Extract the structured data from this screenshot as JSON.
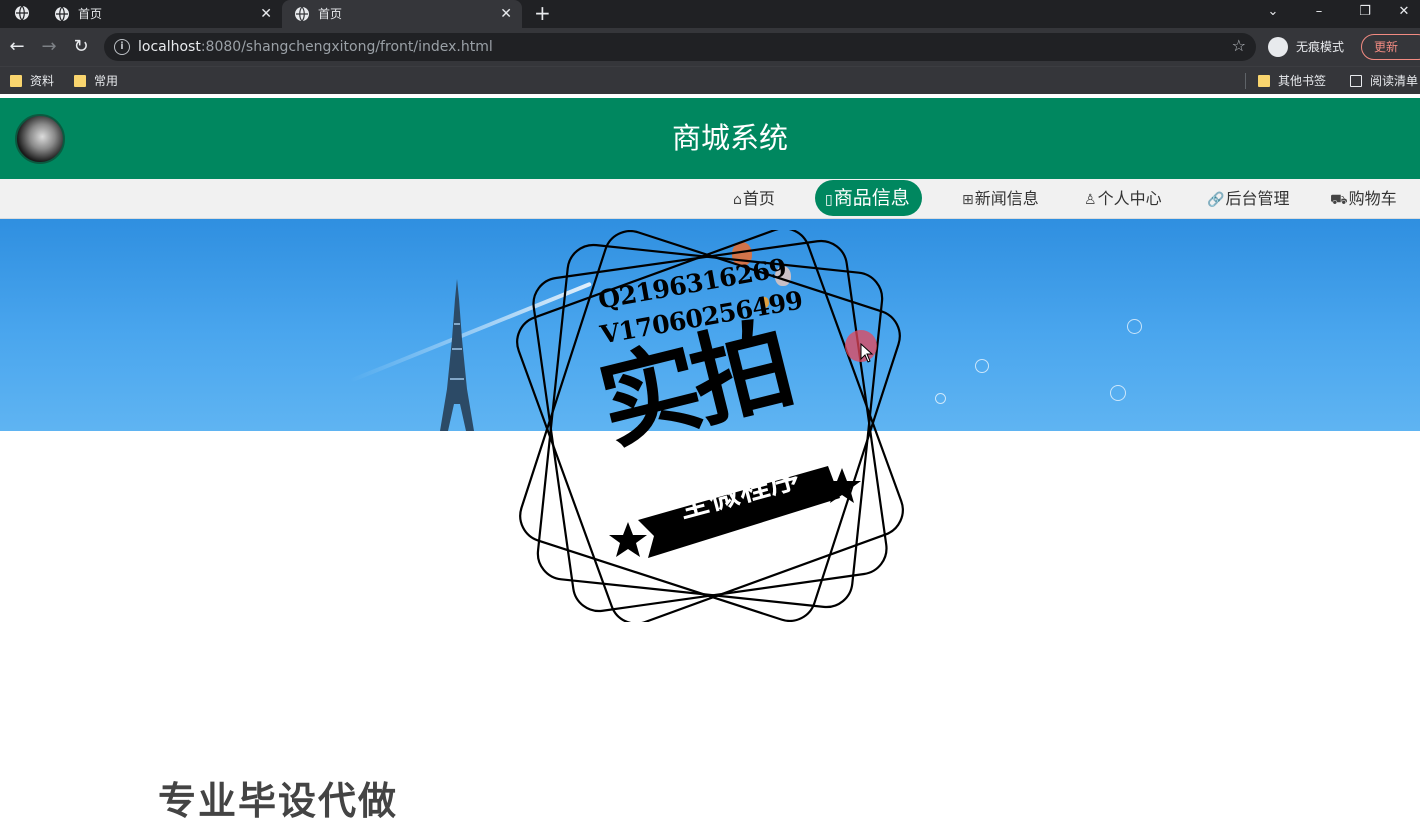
{
  "browser": {
    "tabs": [
      {
        "title": "首页",
        "active": false
      },
      {
        "title": "首页",
        "active": true
      }
    ],
    "new_tab_symbol": "+",
    "window_controls": {
      "tab_search": "⌄",
      "minimize": "–",
      "restore": "❐",
      "close": "✕"
    },
    "url_host": "localhost",
    "url_rest": ":8080/shangchengxitong/front/index.html",
    "incognito_label": "无痕模式",
    "update_label": "更新",
    "bookmarks": [
      {
        "label": "资料",
        "type": "folder"
      },
      {
        "label": "常用",
        "type": "folder"
      }
    ],
    "bookmarks_right": [
      {
        "label": "其他书签",
        "type": "folder"
      },
      {
        "label": "阅读清单",
        "type": "list"
      }
    ]
  },
  "site": {
    "title": "商城系统",
    "nav": [
      {
        "label": "首页",
        "icon": "home-icon",
        "glyph": "⌂",
        "active": false
      },
      {
        "label": "商品信息",
        "icon": "doc-icon",
        "glyph": "▯",
        "active": true
      },
      {
        "label": "新闻信息",
        "icon": "gift-icon",
        "glyph": "⊞",
        "active": false
      },
      {
        "label": "个人中心",
        "icon": "user-icon",
        "glyph": "♙",
        "active": false
      },
      {
        "label": "后台管理",
        "icon": "link-icon",
        "glyph": "🔗",
        "active": false
      },
      {
        "label": "购物车",
        "icon": "cart-icon",
        "glyph": "⛟",
        "active": false
      }
    ]
  },
  "watermark": {
    "qq": "Q2196316269",
    "wechat": "V17060256499",
    "main": "实拍",
    "ribbon": "全微程序"
  },
  "footer_text": "专业毕设代做",
  "colors": {
    "brand_green": "#00875f",
    "nav_bg": "#f1f1f1",
    "sky": "#4aa6ee"
  }
}
